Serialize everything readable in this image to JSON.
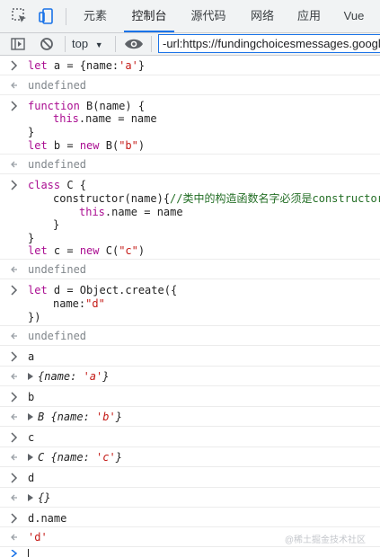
{
  "tabs": [
    "元素",
    "控制台",
    "源代码",
    "网络",
    "应用",
    "Vue"
  ],
  "active_tab": "控制台",
  "toolbar": {
    "context": "top",
    "filter_value": "-url:https://fundingchoicesmessages.google"
  },
  "console": {
    "m1": {
      "code": "let a = {name:'a'}",
      "result": "undefined"
    },
    "m2": {
      "l1": "function B(name) {",
      "l2": "this.name = name",
      "l3": "}",
      "l4": "let b = new B(\"b\")",
      "result": "undefined"
    },
    "m3": {
      "l1": "class C {",
      "l2": "constructor(name){",
      "l2c": "//类中的构造函数名字必须是constructor",
      "l3": "this.name = name",
      "l4": "}",
      "l5": "}",
      "l6": "let c = new C(\"c\")",
      "result": "undefined"
    },
    "m4": {
      "l1": "let d = Object.create({",
      "l2": "name:\"d\"",
      "l3": "})",
      "result": "undefined"
    },
    "m5": {
      "input": "a",
      "prefix": "",
      "body": "{name: 'a'}"
    },
    "m6": {
      "input": "b",
      "prefix": "B",
      "body": "{name: 'b'}"
    },
    "m7": {
      "input": "c",
      "prefix": "C",
      "body": "{name: 'c'}"
    },
    "m8": {
      "input": "d",
      "prefix": "",
      "body": "{}"
    },
    "m9": {
      "input": "d.name",
      "result": "'d'"
    }
  },
  "watermark": "@稀土掘金技术社区"
}
